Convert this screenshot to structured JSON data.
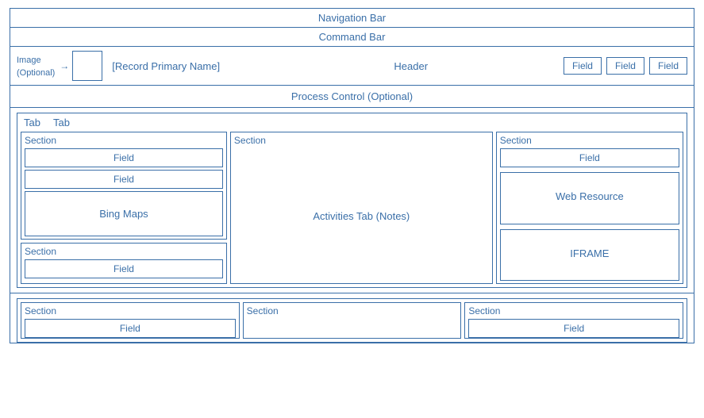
{
  "bars": {
    "navigation": "Navigation Bar",
    "command": "Command Bar"
  },
  "header": {
    "image_label_line1": "Image",
    "image_label_line2": "(Optional)",
    "record_name": "[Record Primary Name]",
    "label": "Header",
    "field1": "Field",
    "field2": "Field",
    "field3": "Field"
  },
  "process_bar": "Process Control (Optional)",
  "tabs": {
    "tab1": "Tab",
    "tab2": "Tab"
  },
  "left_column": {
    "section_label": "Section",
    "field1": "Field",
    "field2": "Field",
    "bing_maps": "Bing Maps",
    "section2_label": "Section",
    "field3": "Field"
  },
  "middle_column": {
    "section_label": "Section",
    "activities": "Activities Tab (Notes)"
  },
  "right_column": {
    "section_label": "Section",
    "field1": "Field",
    "web_resource": "Web Resource",
    "iframe": "IFRAME"
  },
  "bottom": {
    "col1_section": "Section",
    "col1_field": "Field",
    "col2_section": "Section",
    "col3_section": "Section",
    "col3_field": "Field"
  }
}
